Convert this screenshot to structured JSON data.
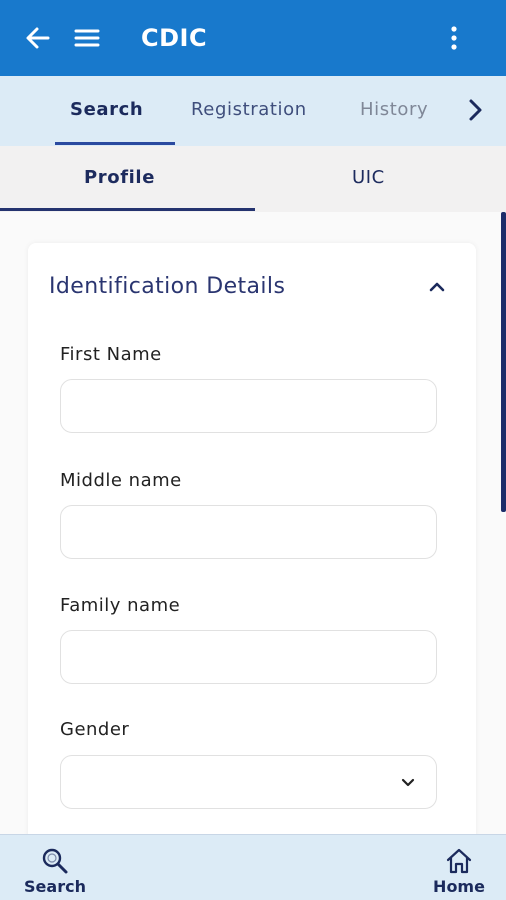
{
  "app": {
    "title": "CDIC",
    "brand_color": "#1879cc"
  },
  "top_tabs": [
    {
      "label": "Search",
      "active": true
    },
    {
      "label": "Registration",
      "active": false
    },
    {
      "label": "History",
      "active": false
    }
  ],
  "sub_tabs": [
    {
      "label": "Profile",
      "active": true
    },
    {
      "label": "UIC",
      "active": false
    }
  ],
  "section": {
    "title": "Identification Details",
    "expanded": true
  },
  "form": {
    "first_name": {
      "label": "First Name",
      "value": ""
    },
    "middle_name": {
      "label": "Middle name",
      "value": ""
    },
    "family_name": {
      "label": "Family name",
      "value": ""
    },
    "gender": {
      "label": "Gender",
      "value": ""
    }
  },
  "bottom_nav": [
    {
      "label": "Search",
      "icon": "search-icon"
    },
    {
      "label": "Home",
      "icon": "home-icon"
    }
  ],
  "icons": [
    "arrow-left-icon",
    "hamburger-menu-icon",
    "more-vertical-icon",
    "chevron-right-icon",
    "chevron-up-icon",
    "chevron-down-icon",
    "search-icon",
    "home-icon"
  ]
}
